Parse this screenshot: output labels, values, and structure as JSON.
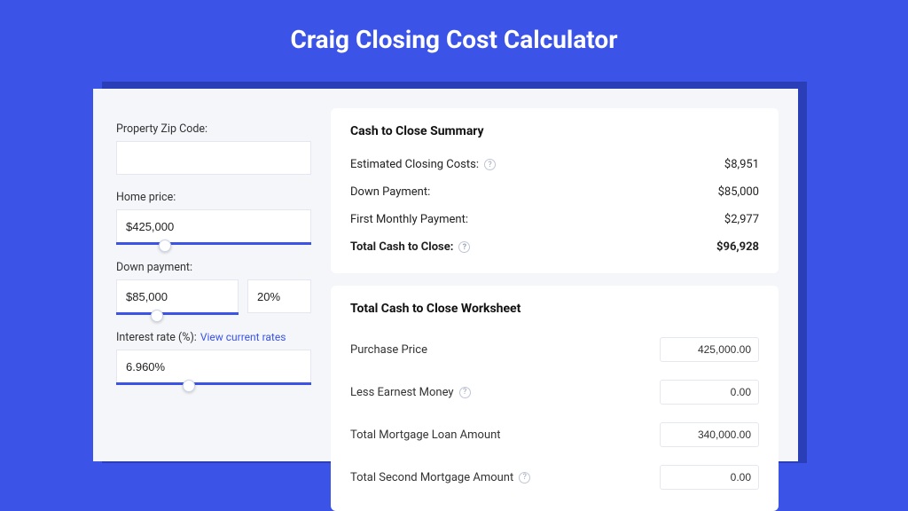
{
  "title": "Craig Closing Cost Calculator",
  "inputs": {
    "zip_label": "Property Zip Code:",
    "zip_value": "",
    "home_price_label": "Home price:",
    "home_price_value": "$425,000",
    "down_payment_label": "Down payment:",
    "down_payment_value": "$85,000",
    "down_payment_pct": "20%",
    "interest_label": "Interest rate (%):",
    "interest_link": "View current rates",
    "interest_value": "6.960%"
  },
  "summary": {
    "heading": "Cash to Close Summary",
    "rows": [
      {
        "label": "Estimated Closing Costs:",
        "help": true,
        "value": "$8,951"
      },
      {
        "label": "Down Payment:",
        "help": false,
        "value": "$85,000"
      },
      {
        "label": "First Monthly Payment:",
        "help": false,
        "value": "$2,977"
      }
    ],
    "total_label": "Total Cash to Close:",
    "total_value": "$96,928"
  },
  "worksheet": {
    "heading": "Total Cash to Close Worksheet",
    "rows": [
      {
        "label": "Purchase Price",
        "help": false,
        "value": "425,000.00"
      },
      {
        "label": "Less Earnest Money",
        "help": true,
        "value": "0.00"
      },
      {
        "label": "Total Mortgage Loan Amount",
        "help": false,
        "value": "340,000.00"
      },
      {
        "label": "Total Second Mortgage Amount",
        "help": true,
        "value": "0.00"
      }
    ]
  }
}
